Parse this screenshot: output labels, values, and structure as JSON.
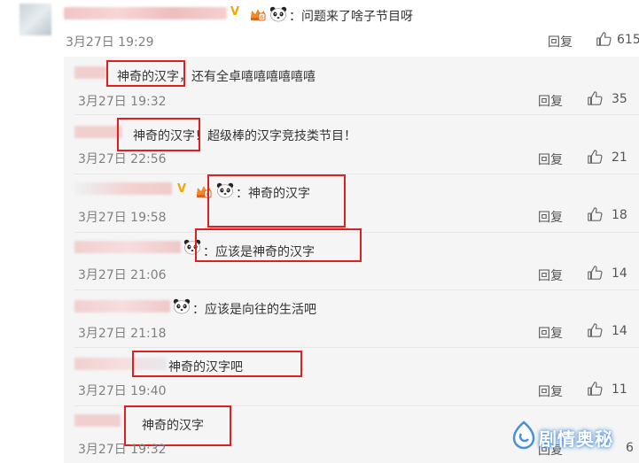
{
  "colors": {
    "accent_red": "#e02020",
    "badge_gold": "#f2a900",
    "watermark_blue": "#4a90d9"
  },
  "top_comment": {
    "v_badge": "V",
    "text": "：问题来了啥子节目呀",
    "time": "3月27日 19:29",
    "reply_label": "回复",
    "likes": "615",
    "icons": [
      "v-verified-icon",
      "crown-badge-icon",
      "panda-emoji-icon",
      "thumbs-up-icon"
    ]
  },
  "replies": [
    {
      "text": "神奇的汉字，还有全卓嘻嘻嘻嘻嘻嘻",
      "time": "3月27日 19:32",
      "reply_label": "回复",
      "likes": "35"
    },
    {
      "text": "神奇的汉字！超级棒的汉字竞技类节目！",
      "time": "3月27日 22:56",
      "reply_label": "回复",
      "likes": "21"
    },
    {
      "v_badge": "V",
      "text": "：神奇的汉字",
      "time": "3月27日 19:58",
      "reply_label": "回复",
      "likes": "18"
    },
    {
      "text": "：应该是神奇的汉字",
      "time": "3月27日 21:06",
      "reply_label": "回复",
      "likes": "14"
    },
    {
      "text": "：应该是向往的生活吧",
      "time": "3月27日 21:18",
      "reply_label": "回复",
      "likes": "14"
    },
    {
      "text": "神奇的汉字吧",
      "time": "3月27日 19:40",
      "reply_label": "回复",
      "likes": "11"
    },
    {
      "text": "神奇的汉字",
      "time": "3月27日 19:32",
      "reply_label": "回复",
      "likes": "6"
    }
  ],
  "watermark": {
    "text": "剧情奥秘"
  }
}
